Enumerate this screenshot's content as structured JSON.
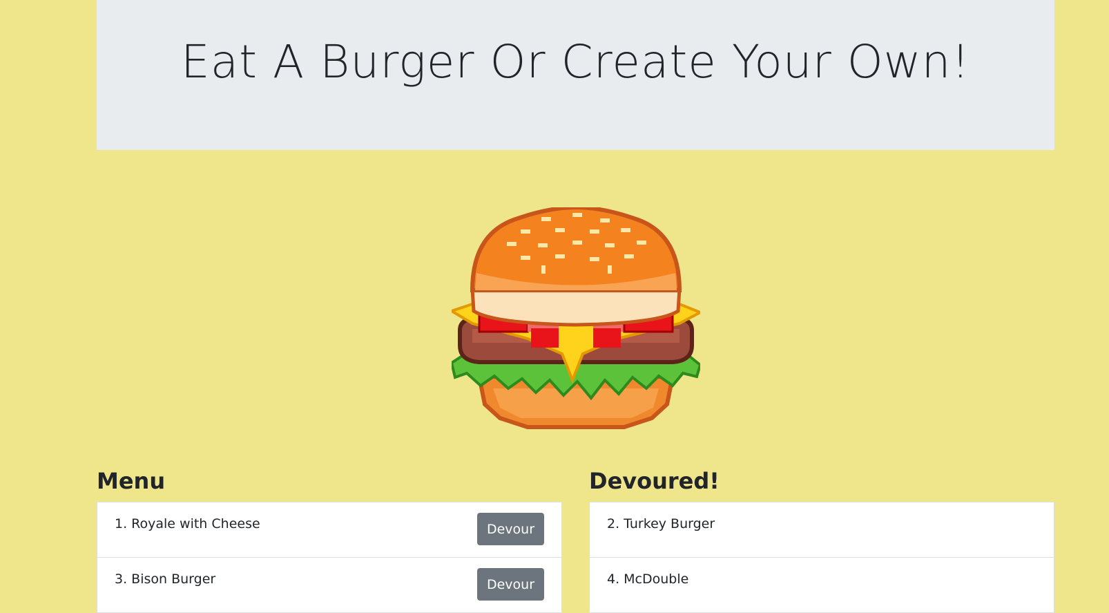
{
  "header": {
    "title": "Eat A Burger Or Create Your Own!"
  },
  "hero": {
    "image_icon": "burger-icon"
  },
  "menu": {
    "heading": "Menu",
    "items": [
      {
        "label": "1. Royale with Cheese",
        "button": "Devour"
      },
      {
        "label": "3. Bison Burger",
        "button": "Devour"
      }
    ]
  },
  "devoured": {
    "heading": "Devoured!",
    "items": [
      {
        "label": "2. Turkey Burger"
      },
      {
        "label": "4. McDouble"
      }
    ]
  },
  "colors": {
    "background": "#efe68b",
    "jumbotron": "#e9ecef",
    "button": "#6c757d"
  }
}
